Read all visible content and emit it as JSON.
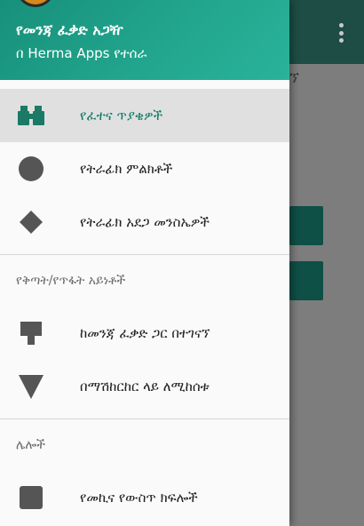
{
  "header": {
    "title": "የመንጃ ፈቃድ አጋዥ",
    "subtitle": "በ Herma Apps የተሰራ"
  },
  "background": {
    "tab_peek": "ኘ"
  },
  "menu": {
    "items": [
      {
        "label": "የፈተና ጥያቄዎች",
        "icon": "binoculars-icon",
        "active": true
      },
      {
        "label": "የትራፊክ ምልክቶች",
        "icon": "circle-icon",
        "active": false
      },
      {
        "label": "የትራፊክ አደጋ መንስኤዎች",
        "icon": "diamond-icon",
        "active": false
      }
    ],
    "section_penalties": {
      "title": "የቅጣት/የጥፋት አይነቶች",
      "items": [
        {
          "label": "ከመንጃ ፈቃድ ጋር በተገናኘ",
          "icon": "shield-sign-icon"
        },
        {
          "label": "በማሽከርከር ላይ ለሚከሰቱ",
          "icon": "triangle-down-icon"
        }
      ]
    },
    "section_others": {
      "title": "ሌሎች",
      "items": [
        {
          "label": "የመኪና የውስጥ ክፍሎች",
          "icon": "square-icon"
        }
      ]
    }
  },
  "colors": {
    "accent": "#22a58d",
    "active_label": "#0f7a64",
    "icon_gray": "#555555",
    "toolbar_dim": "#1d4d45"
  }
}
